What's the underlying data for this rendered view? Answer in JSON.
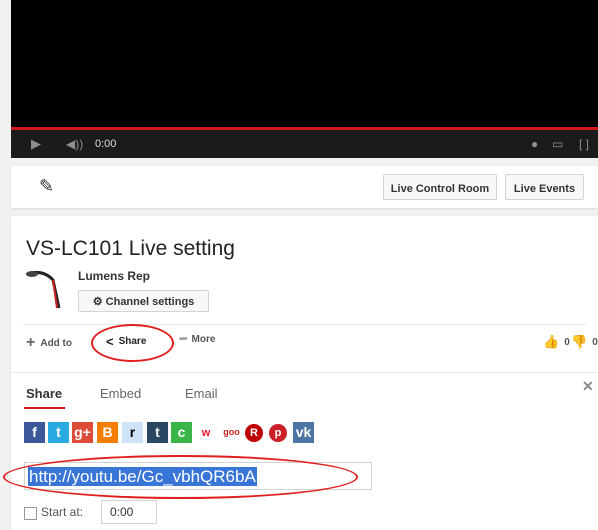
{
  "player": {
    "time": "0:00"
  },
  "toolbar": {
    "live_control_room": "Live Control Room",
    "live_events": "Live Events"
  },
  "video": {
    "title": "VS-LC101 Live setting",
    "channel": "Lumens Rep",
    "channel_settings": "Channel settings"
  },
  "actions": {
    "add_to": "Add to",
    "share": "Share",
    "more": "More",
    "likes": "0",
    "dislikes": "0"
  },
  "share_panel": {
    "tabs": [
      "Share",
      "Embed",
      "Email"
    ],
    "active_tab": "Share",
    "social": [
      {
        "name": "facebook-icon",
        "glyph": "f",
        "color": "#3b5998"
      },
      {
        "name": "twitter-icon",
        "glyph": "t",
        "color": "#2ba9e1"
      },
      {
        "name": "googleplus-icon",
        "glyph": "g+",
        "color": "#dd4b39"
      },
      {
        "name": "blogger-icon",
        "glyph": "B",
        "color": "#f57d00"
      },
      {
        "name": "reddit-icon",
        "glyph": "r",
        "color": "#cee3f8"
      },
      {
        "name": "tumblr-icon",
        "glyph": "t",
        "color": "#2c4762"
      },
      {
        "name": "cyworld-icon",
        "glyph": "c",
        "color": "#3ab54a"
      },
      {
        "name": "weibo-icon",
        "glyph": "w",
        "color": "#e6162d"
      },
      {
        "name": "goo-icon",
        "glyph": "goo",
        "color": "#ffffff"
      },
      {
        "name": "rakuten-icon",
        "glyph": "R",
        "color": "#bf0000"
      },
      {
        "name": "pinterest-icon",
        "glyph": "p",
        "color": "#cb2027"
      },
      {
        "name": "vk-icon",
        "glyph": "vk",
        "color": "#4c75a3"
      }
    ],
    "url": "http://youtu.be/Gc_vbhQR6bA",
    "start_at_label": "Start at:",
    "start_at_value": "0:00"
  }
}
